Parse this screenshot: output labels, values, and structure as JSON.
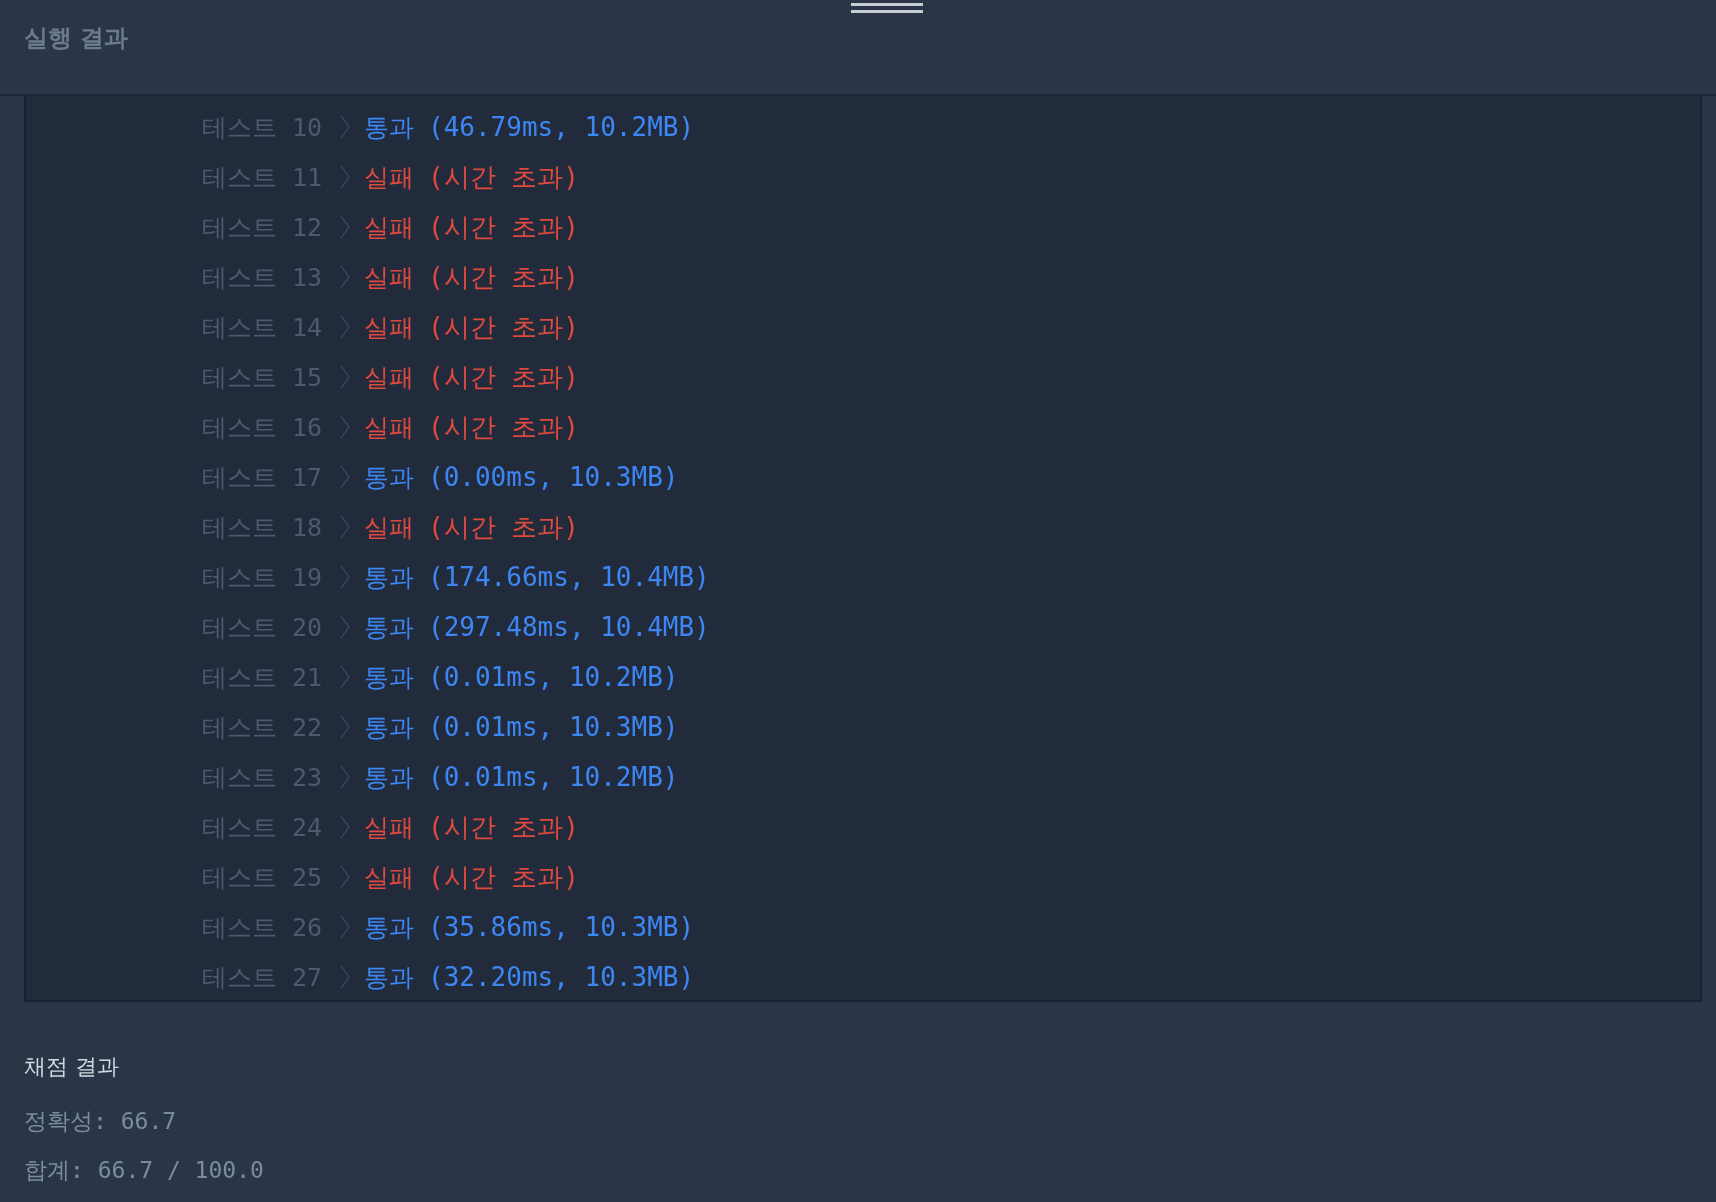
{
  "header": {
    "title": "실행 결과"
  },
  "tests": [
    {
      "label": "테스트 10",
      "kind": "pass",
      "status": "통과",
      "detail": "(46.79ms, 10.2MB)"
    },
    {
      "label": "테스트 11",
      "kind": "fail",
      "status": "실패",
      "detail": "(시간 초과)"
    },
    {
      "label": "테스트 12",
      "kind": "fail",
      "status": "실패",
      "detail": "(시간 초과)"
    },
    {
      "label": "테스트 13",
      "kind": "fail",
      "status": "실패",
      "detail": "(시간 초과)"
    },
    {
      "label": "테스트 14",
      "kind": "fail",
      "status": "실패",
      "detail": "(시간 초과)"
    },
    {
      "label": "테스트 15",
      "kind": "fail",
      "status": "실패",
      "detail": "(시간 초과)"
    },
    {
      "label": "테스트 16",
      "kind": "fail",
      "status": "실패",
      "detail": "(시간 초과)"
    },
    {
      "label": "테스트 17",
      "kind": "pass",
      "status": "통과",
      "detail": "(0.00ms, 10.3MB)"
    },
    {
      "label": "테스트 18",
      "kind": "fail",
      "status": "실패",
      "detail": "(시간 초과)"
    },
    {
      "label": "테스트 19",
      "kind": "pass",
      "status": "통과",
      "detail": "(174.66ms, 10.4MB)"
    },
    {
      "label": "테스트 20",
      "kind": "pass",
      "status": "통과",
      "detail": "(297.48ms, 10.4MB)"
    },
    {
      "label": "테스트 21",
      "kind": "pass",
      "status": "통과",
      "detail": "(0.01ms, 10.2MB)"
    },
    {
      "label": "테스트 22",
      "kind": "pass",
      "status": "통과",
      "detail": "(0.01ms, 10.3MB)"
    },
    {
      "label": "테스트 23",
      "kind": "pass",
      "status": "통과",
      "detail": "(0.01ms, 10.2MB)"
    },
    {
      "label": "테스트 24",
      "kind": "fail",
      "status": "실패",
      "detail": "(시간 초과)"
    },
    {
      "label": "테스트 25",
      "kind": "fail",
      "status": "실패",
      "detail": "(시간 초과)"
    },
    {
      "label": "테스트 26",
      "kind": "pass",
      "status": "통과",
      "detail": "(35.86ms, 10.3MB)"
    },
    {
      "label": "테스트 27",
      "kind": "pass",
      "status": "통과",
      "detail": "(32.20ms, 10.3MB)"
    }
  ],
  "summary": {
    "title": "채점 결과",
    "lines": [
      "정확성: 66.7",
      "합계: 66.7 / 100.0"
    ]
  }
}
